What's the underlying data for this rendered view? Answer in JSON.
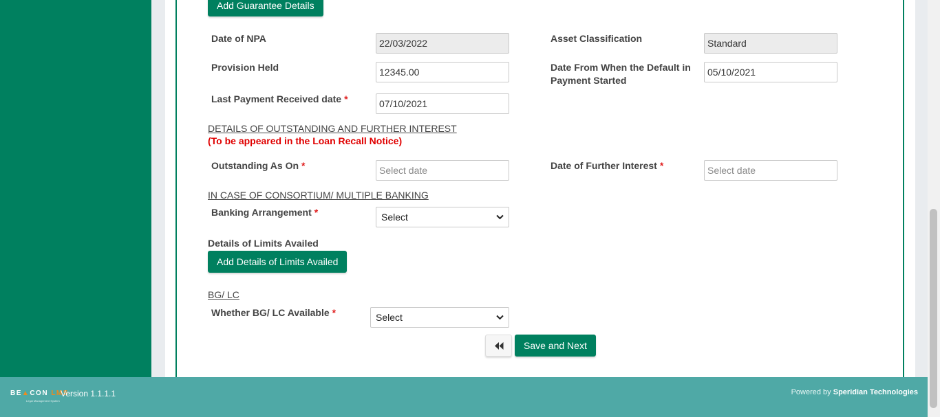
{
  "buttons": {
    "add_guarantee": "Add Guarantee Details",
    "add_limits": "Add Details of Limits Availed",
    "save_next": "Save and Next"
  },
  "fields": {
    "date_of_npa": {
      "label": "Date of NPA",
      "value": "22/03/2022"
    },
    "asset_classification": {
      "label": "Asset Classification",
      "value": "Standard"
    },
    "provision_held": {
      "label": "Provision Held",
      "value": "12345.00"
    },
    "default_date": {
      "label_line1": "Date From When the Default in",
      "label_line2": "Payment Started",
      "value": "05/10/2021"
    },
    "last_payment": {
      "label": "Last Payment Received date",
      "required": "*",
      "value": "07/10/2021"
    },
    "outstanding_as_on": {
      "label": "Outstanding As On",
      "required": "*",
      "placeholder": "Select date"
    },
    "further_interest": {
      "label": "Date of Further Interest",
      "required": "*",
      "placeholder": "Select date"
    },
    "banking_arrangement": {
      "label": "Banking Arrangement",
      "required": "*",
      "value": "Select"
    },
    "bg_lc_available": {
      "label": "Whether BG/ LC Available",
      "required": "*",
      "value": "Select"
    }
  },
  "sections": {
    "outstanding_title": "DETAILS OF OUTSTANDING AND FURTHER INTEREST",
    "outstanding_note": "(To be appeared in the Loan Recall Notice)",
    "consortium_title": "IN CASE OF CONSORTIUM/ MULTIPLE BANKING",
    "limits_title": "Details of Limits Availed",
    "bglc_title": "BG/ LC"
  },
  "footer": {
    "logo_part1": "BE",
    "logo_part2": "CON",
    "logo_part3": "LMS",
    "logo_sub": "Legal Management System",
    "version": "Version 1.1.1.1",
    "powered_by": "Powered by",
    "company": "Speridian Technologies"
  },
  "colors": {
    "primary": "#00805f",
    "footer": "#4fa9a6",
    "required": "#e02020",
    "note": "#e00000"
  }
}
